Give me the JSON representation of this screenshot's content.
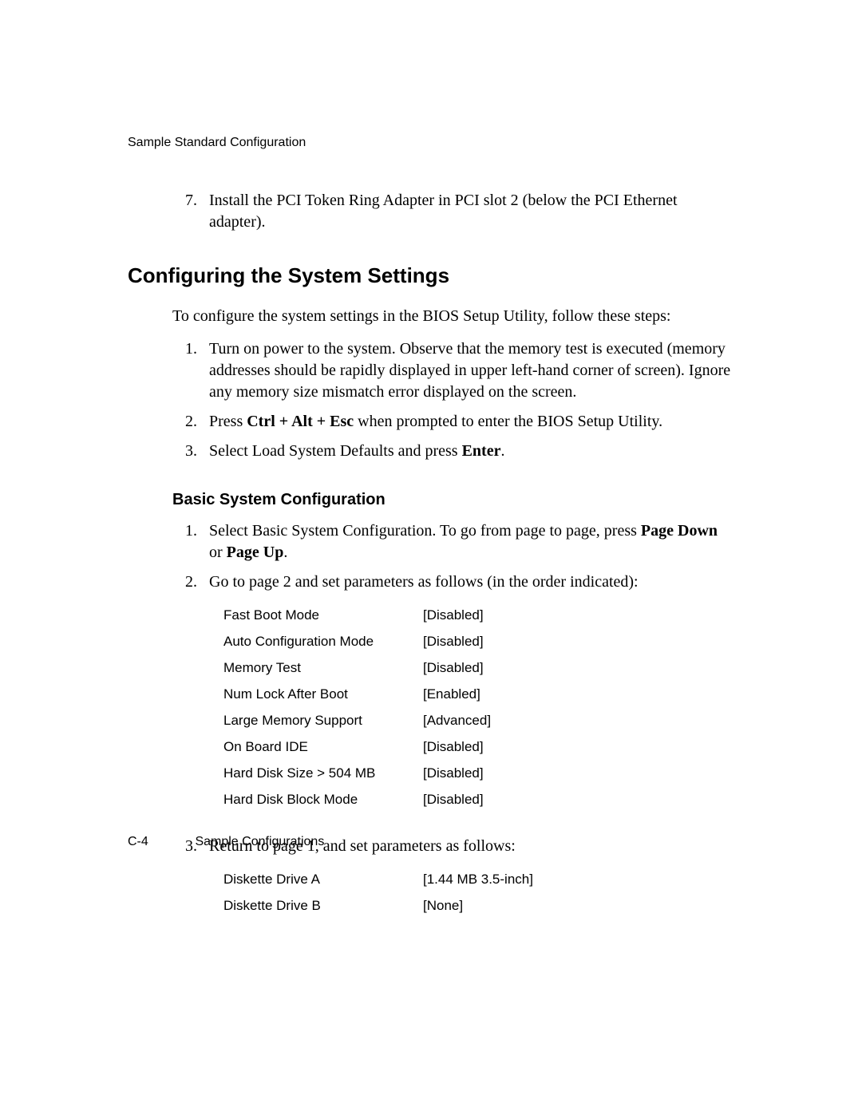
{
  "running_head": "Sample Standard Configuration",
  "item7_prefix": "Install the PCI Token Ring Adapter in PCI slot 2 (below the PCI Ethernet adapter).",
  "h1": "Configuring the System Settings",
  "intro": "To configure the system settings in the BIOS Setup Utility, follow these steps:",
  "steps": {
    "s1": "Turn on power to the system. Observe that the memory test is executed (memory addresses should be rapidly displayed in upper left-hand corner of screen). Ignore any memory size mismatch error displayed on the screen.",
    "s2_a": "Press ",
    "s2_b": "Ctrl + Alt + Esc",
    "s2_c": " when prompted to enter the BIOS Setup Utility.",
    "s3_a": "Select Load System Defaults and press ",
    "s3_b": "Enter",
    "s3_c": "."
  },
  "h2": "Basic System Configuration",
  "bsc": {
    "s1_a": "Select Basic System Configuration. To go from page to page, press ",
    "s1_b": "Page Down",
    "s1_c": " or ",
    "s1_d": "Page Up",
    "s1_e": ".",
    "s2": "Go to page 2 and set parameters as follows (in the order indicated):",
    "s3": "Return to page 1, and set parameters as follows:"
  },
  "table_page2": [
    {
      "label": "Fast Boot Mode",
      "value": "[Disabled]"
    },
    {
      "label": "Auto Configuration Mode",
      "value": "[Disabled]"
    },
    {
      "label": "Memory Test",
      "value": "[Disabled]"
    },
    {
      "label": "Num Lock After Boot",
      "value": "[Enabled]"
    },
    {
      "label": "Large Memory Support",
      "value": "[Advanced]"
    },
    {
      "label": "On Board IDE",
      "value": "[Disabled]"
    },
    {
      "label": "Hard Disk Size > 504 MB",
      "value": "[Disabled]"
    },
    {
      "label": "Hard Disk Block Mode",
      "value": "[Disabled]"
    }
  ],
  "table_page1": [
    {
      "label": "Diskette Drive A",
      "value": "[1.44 MB 3.5-inch]"
    },
    {
      "label": "Diskette Drive B",
      "value": "[None]"
    }
  ],
  "footer": {
    "page_number": "C-4",
    "section": "Sample Configurations"
  }
}
